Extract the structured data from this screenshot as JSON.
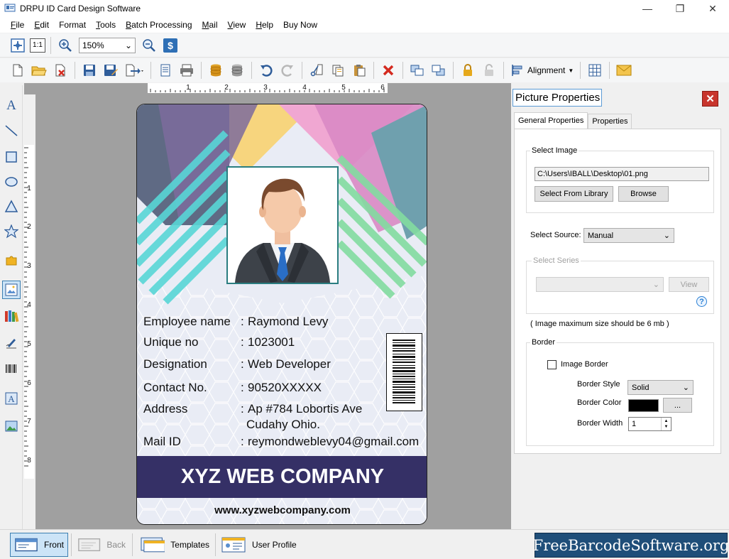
{
  "window": {
    "title": "DRPU ID Card Design Software",
    "controls": [
      "—",
      "❐",
      "✕"
    ]
  },
  "menu": {
    "items": [
      {
        "label": "File",
        "u": "F",
        "rest": "ile"
      },
      {
        "label": "Edit",
        "u": "E",
        "rest": "dit"
      },
      {
        "label": "Format",
        "u": "",
        "rest": "Format"
      },
      {
        "label": "Tools",
        "u": "T",
        "rest": "ools"
      },
      {
        "label": "Batch Processing",
        "u": "B",
        "rest": "atch Processing"
      },
      {
        "label": "Mail",
        "u": "M",
        "rest": "ail"
      },
      {
        "label": "View",
        "u": "V",
        "rest": "iew"
      },
      {
        "label": "Help",
        "u": "H",
        "rest": "elp"
      },
      {
        "label": "Buy Now",
        "u": "",
        "rest": "Buy Now"
      }
    ]
  },
  "toolbar": {
    "zoom_value": "150%",
    "fit_label": "1:1",
    "alignment_label": "Alignment"
  },
  "ruler": {
    "h_ticks": [
      "1",
      "2",
      "3",
      "4",
      "5",
      "6"
    ],
    "v_ticks": [
      "1",
      "2",
      "3",
      "4",
      "5",
      "6",
      "7",
      "8"
    ]
  },
  "card": {
    "fields": [
      {
        "label": "Employee name",
        "value": "Raymond Levy"
      },
      {
        "label": "Unique no",
        "value": "1023001"
      },
      {
        "label": "Designation",
        "value": "Web Developer"
      },
      {
        "label": "Contact No.",
        "value": "90520XXXXX"
      },
      {
        "label": "Address",
        "value": "Ap #784 Lobortis Ave",
        "value2": "Cudahy Ohio."
      },
      {
        "label": "Mail ID",
        "value": "reymondweblevy04@gmail.com"
      }
    ],
    "colon": ":",
    "company": "XYZ WEB COMPANY",
    "website": "www.xyzwebcompany.com"
  },
  "panel": {
    "title": "Picture Properties",
    "close": "✕",
    "tabs": [
      "General Properties",
      "Properties"
    ],
    "select_image_label": "Select Image",
    "image_path": "C:\\Users\\IBALL\\Desktop\\01.png",
    "select_from_library": "Select From Library",
    "browse": "Browse",
    "select_source_label": "Select Source:",
    "select_source_value": "Manual",
    "select_series_label": "Select Series",
    "view_button": "View",
    "help": "?",
    "max_size_note": "( Image maximum size should be 6 mb )",
    "border_group": "Border",
    "image_border_label": "Image Border",
    "border_style_label": "Border Style",
    "border_style_value": "Solid",
    "border_color_label": "Border Color",
    "border_color_value": "#000000",
    "border_color_button": "...",
    "border_width_label": "Border Width",
    "border_width_value": "1"
  },
  "bottom": {
    "front": "Front",
    "back": "Back",
    "templates": "Templates",
    "user_profile": "User Profile"
  },
  "watermark": "FreeBarcodeSoftware.org"
}
